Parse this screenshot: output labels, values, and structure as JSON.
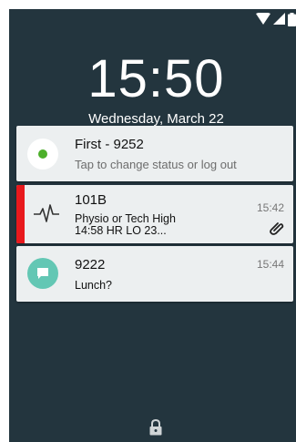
{
  "lockscreen": {
    "clock": "15:50",
    "date": "Wednesday, March 22"
  },
  "notifications": [
    {
      "title": "First - 9252",
      "subtitle": "Tap to change status or log out",
      "icon": "online-status-dot-icon",
      "status_color": "#4caf2a"
    },
    {
      "title": "101B",
      "line1": "Physio or Tech High",
      "line2": "14:58 HR LO 23...",
      "time": "15:42",
      "icon": "heartbeat-icon",
      "accent_color": "#e8191d",
      "attachment_icon": "paperclip-icon"
    },
    {
      "title": "9222",
      "line1": "Lunch?",
      "time": "15:44",
      "icon": "message-bubble-icon",
      "icon_color": "#63c7b4"
    }
  ],
  "colors": {
    "background": "#23353e",
    "card": "#eceff0"
  }
}
